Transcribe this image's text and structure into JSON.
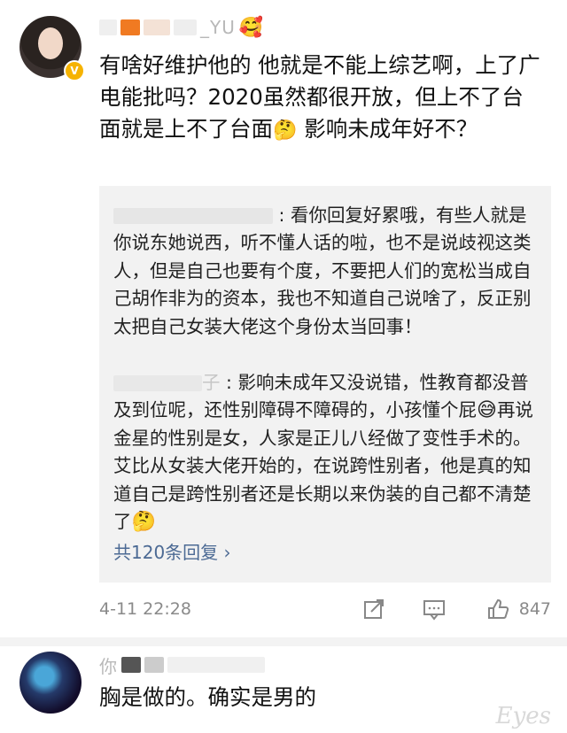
{
  "comments": [
    {
      "username": "_YU",
      "text_a": "有啥好维护他的 他就是不能上综艺啊，上了广电能批吗？2020虽然都很开放，但上不了台面就是上不了台面",
      "text_b": " 影响未成年好不？",
      "emoji_1": "🤔",
      "replies": [
        {
          "name": "",
          "sep": ": ",
          "text": "看你回复好累哦，有些人就是你说东她说西，听不懂人话的啦，也不是说歧视这类人，但是自己也要有个度，不要把人们的宽松当成自己胡作非为的资本，我也不知道自己说啥了，反正别太把自己女装大佬这个身份太当回事！"
        },
        {
          "name": "子",
          "sep": ": ",
          "text_a": "影响未成年又没说错，性教育都没普及到位呢，还性别障碍不障碍的，小孩懂个屁",
          "emoji": "😅",
          "text_b": "再说金星的性别是女，人家是正儿八经做了变性手术的。艾比从女装大佬开始的，在说跨性别者，他是真的知道自己是跨性别者还是长期以来伪装的自己都不清楚了",
          "emoji_2": "🤔"
        }
      ],
      "more_replies": "共120条回复 ›",
      "time": "4-11 22:28",
      "like_count": "847",
      "icons": [
        "share-icon",
        "comment-icon",
        "like-icon"
      ]
    },
    {
      "username": "你",
      "text": "胸是做的。确实是男的"
    }
  ],
  "watermark": "Eyes"
}
